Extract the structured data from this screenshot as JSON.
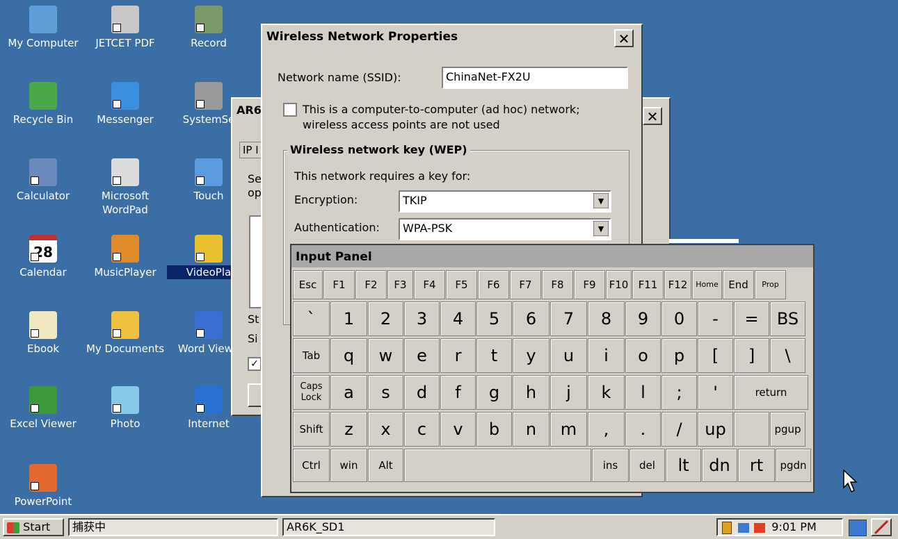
{
  "desktop": {
    "icons": [
      {
        "label": "My Computer",
        "color": "#5f9fd8"
      },
      {
        "label": "JETCET PDF",
        "color": "#c8c8c8"
      },
      {
        "label": "Record",
        "color": "#7a9a6a"
      },
      {
        "label": "Recycle Bin",
        "color": "#4aa84a"
      },
      {
        "label": "Messenger",
        "color": "#3b8fe0"
      },
      {
        "label": "SystemSe",
        "color": "#9a9a9a"
      },
      {
        "label": "Calculator",
        "color": "#6b8bbf"
      },
      {
        "label": "Microsoft WordPad",
        "color": "#dcdcdc"
      },
      {
        "label": "Touch",
        "color": "#5c9be0"
      },
      {
        "label": "Calendar",
        "color": "#ffffff"
      },
      {
        "label": "MusicPlayer",
        "color": "#e08a2a"
      },
      {
        "label": "VideoPla",
        "color": "#e8c030"
      },
      {
        "label": "Ebook",
        "color": "#f0e8c0"
      },
      {
        "label": "My Documents",
        "color": "#f0c040"
      },
      {
        "label": "Word Viewe",
        "color": "#3a6ed0"
      },
      {
        "label": "Excel Viewer",
        "color": "#3c9a3c"
      },
      {
        "label": "Photo",
        "color": "#88c8e8"
      },
      {
        "label": "Internet",
        "color": "#2a70d0"
      },
      {
        "label": "PowerPoint",
        "color": "#e06a30"
      }
    ],
    "calendar_day": "28"
  },
  "back_window": {
    "title": "AR6",
    "tab": "IP I",
    "text_se": "Se",
    "text_op": "op",
    "text_st": "St",
    "text_si": "Si",
    "group_label": "I"
  },
  "wireless_dialog": {
    "title": "Wireless Network Properties",
    "close": "✕",
    "ssid_label": "Network name (SSID):",
    "ssid_value": "ChinaNet-FX2U",
    "adhoc_line1": "This is a computer-to-computer (ad hoc) network;",
    "adhoc_line2": "wireless access points are not used",
    "wep_group": "Wireless network key (WEP)",
    "requires_key": "This network requires a key for:",
    "encryption_label": "Encryption:",
    "encryption_value": "TKIP",
    "auth_label": "Authentication:",
    "auth_value": "WPA-PSK"
  },
  "input_panel": {
    "title": "Input Panel",
    "rows": [
      [
        "Esc",
        "F1",
        "F2",
        "F3",
        "F4",
        "F5",
        "F6",
        "F7",
        "F8",
        "F9",
        "F10",
        "F11",
        "F12",
        "Home",
        "End",
        "Prop"
      ],
      [
        "`",
        "1",
        "2",
        "3",
        "4",
        "5",
        "6",
        "7",
        "8",
        "9",
        "0",
        "-",
        "=",
        "BS"
      ],
      [
        "Tab",
        "q",
        "w",
        "e",
        "r",
        "t",
        "y",
        "u",
        "i",
        "o",
        "p",
        "[",
        "]",
        "\\"
      ],
      [
        "Caps Lock",
        "a",
        "s",
        "d",
        "f",
        "g",
        "h",
        "j",
        "k",
        "l",
        ";",
        "'",
        "return"
      ],
      [
        "Shift",
        "z",
        "x",
        "c",
        "v",
        "b",
        "n",
        "m",
        ",",
        ".",
        "/",
        "up",
        "",
        "pgup"
      ],
      [
        "Ctrl",
        "win",
        "Alt",
        "",
        "ins",
        "del",
        "lt",
        "dn",
        "rt",
        "pgdn"
      ]
    ]
  },
  "taskbar": {
    "start_label": "Start",
    "task1": "捕获中",
    "task2": "AR6K_SD1",
    "clock": "9:01 PM"
  }
}
